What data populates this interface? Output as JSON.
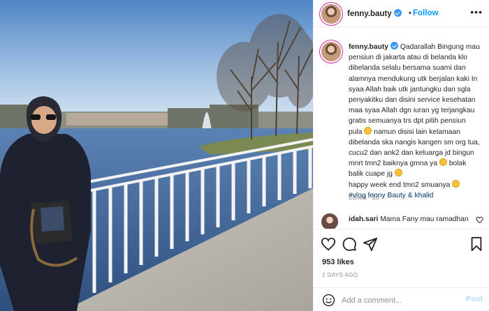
{
  "header": {
    "username": "fenny.bauty",
    "verified": true,
    "separator": "•",
    "follow_label": "Follow",
    "more_icon": "more-options-icon",
    "more_glyph": "•••"
  },
  "caption": {
    "username": "fenny.bauty",
    "verified": true,
    "lines": [
      "Qadarallah Bingung mau",
      "pensiun di jakarta atau di belanda klo",
      "dibelanda selalu bersama suami dan",
      "alamnya mendukung utk berjalan kaki In",
      "syaa Allah baik utk jantungku dan sgla",
      "penyakitku dan disini service kesehatan",
      "maa syaa Allah dgn iuran yg terjangkau",
      "gratis semuanya trs dpt pitih pensiun",
      "pula",
      "namun disisi lain kelamaan",
      "dibelanda ska nangis kangen sm org tua,",
      "cucu2 dan ank2 dan keluarga jd bingun",
      "mnrt tmn2 baiknya gmna ya",
      "bolak",
      "balik cuape jg",
      "happy week end tmn2 smuanya",
      "#vlog fenny Bauty & khalid"
    ],
    "meta": "Edited · 1d"
  },
  "comment": {
    "username": "idah.sari",
    "text": "Mama Fany mau ramadhan"
  },
  "actions": {
    "icons": [
      "heart-icon",
      "comment-icon",
      "share-icon",
      "bookmark-icon"
    ],
    "likes": "953 likes",
    "date": "2 DAYS AGO"
  },
  "add_comment": {
    "placeholder": "Add a comment...",
    "post_label": "Post"
  },
  "colors": {
    "accent": "#0095f6",
    "verified": "#3897f0",
    "text": "#262626",
    "muted": "#8e8e8e",
    "post_disabled": "#b2dffc"
  }
}
